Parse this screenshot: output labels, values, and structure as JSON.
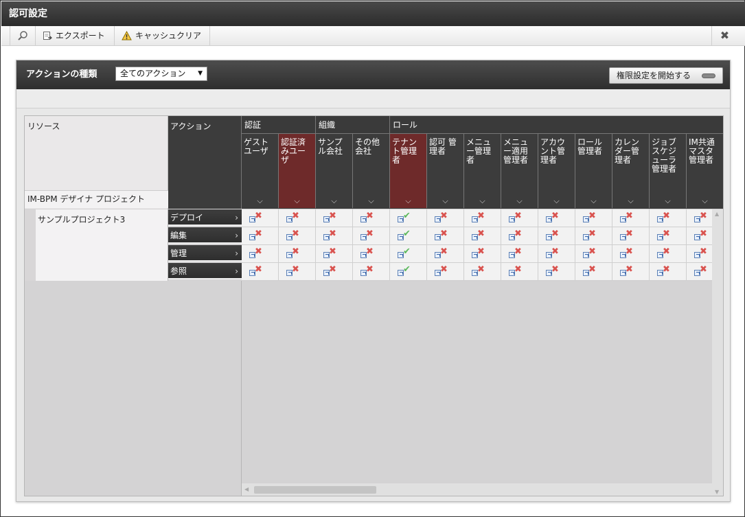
{
  "window": {
    "title": "認可設定"
  },
  "toolbar": {
    "search_icon": "search-icon",
    "export_label": "エクスポート",
    "cache_clear_label": "キャッシュクリア",
    "close_icon": "close-icon"
  },
  "panel": {
    "action_type_label": "アクションの種類",
    "action_type_selected": "全てのアクション",
    "start_button_label": "権限設定を開始する"
  },
  "grid": {
    "resource_header": "リソース",
    "project_header": "IM-BPM デザイナ プロジェクト",
    "action_header": "アクション",
    "groups": [
      {
        "label": "認証"
      },
      {
        "label": "組織"
      },
      {
        "label": "ロール"
      }
    ],
    "columns": [
      {
        "label": "ゲストユーザ",
        "highlight": false
      },
      {
        "label": "認証済みユーザ",
        "highlight": true
      },
      {
        "label": "サンプル会社",
        "highlight": false
      },
      {
        "label": "その他会社",
        "highlight": false
      },
      {
        "label": "テナント管理者",
        "highlight": true
      },
      {
        "label": "認可 管理者",
        "highlight": false
      },
      {
        "label": "メニュー管理者",
        "highlight": false
      },
      {
        "label": "メニュー適用管理者",
        "highlight": false
      },
      {
        "label": "アカウント管理者",
        "highlight": false
      },
      {
        "label": "ロール管理者",
        "highlight": false
      },
      {
        "label": "カレンダー管理者",
        "highlight": false
      },
      {
        "label": "ジョブスケジューラ管理者",
        "highlight": false
      },
      {
        "label": "IM共通マスタ管理者",
        "highlight": false
      }
    ],
    "resource": {
      "name": "サンプルプロジェクト3",
      "actions": [
        "デプロイ",
        "編集",
        "管理",
        "参照"
      ]
    },
    "permissions": [
      [
        "deny",
        "deny",
        "deny",
        "deny",
        "allow",
        "deny",
        "deny",
        "deny",
        "deny",
        "deny",
        "deny",
        "deny",
        "deny"
      ],
      [
        "deny",
        "deny",
        "deny",
        "deny",
        "allow",
        "deny",
        "deny",
        "deny",
        "deny",
        "deny",
        "deny",
        "deny",
        "deny"
      ],
      [
        "deny",
        "deny",
        "deny",
        "deny",
        "allow",
        "deny",
        "deny",
        "deny",
        "deny",
        "deny",
        "deny",
        "deny",
        "deny"
      ],
      [
        "deny",
        "deny",
        "deny",
        "deny",
        "allow",
        "deny",
        "deny",
        "deny",
        "deny",
        "deny",
        "deny",
        "deny",
        "deny"
      ]
    ]
  },
  "colors": {
    "header_dark": "#3c3c3c",
    "highlight": "#6e2a2a",
    "deny": "#d9534f",
    "allow": "#5cb85c"
  }
}
